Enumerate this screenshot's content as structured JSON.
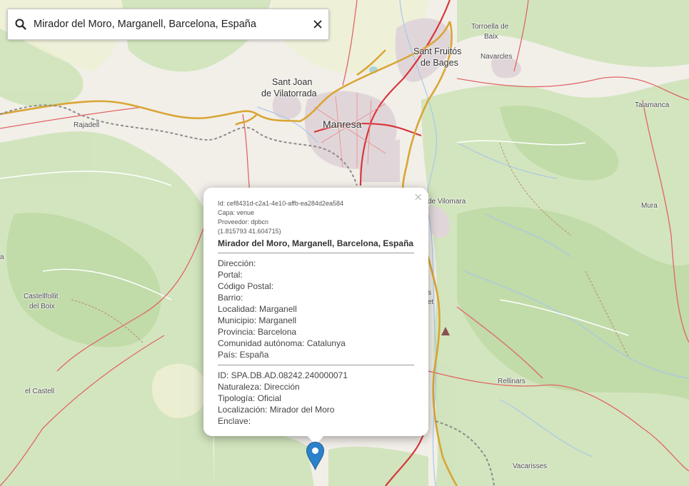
{
  "search": {
    "value": "Mirador del Moro, Marganell, Barcelona, España",
    "placeholder": ""
  },
  "map": {
    "places": {
      "manresa": "Manresa",
      "sant_joan_1": "Sant Joan",
      "sant_joan_2": "de Vilatorrada",
      "sant_fruitos_1": "Sant Fruitós",
      "sant_fruitos_2": "de Bages",
      "torroella_1": "Torroella de",
      "torroella_2": "Baix",
      "navarcles": "Navarcles",
      "talamanca": "Talamanca",
      "rajadell": "Rajadell",
      "vilomara": "de Vilomara",
      "mura": "Mura",
      "castellfollit_1": "Castellfollit",
      "castellfollit_2": "del Boix",
      "el_castell": "el Castell",
      "rellinars": "Rellinars",
      "vacarisses": "Vacarisses",
      "a_edge": "a",
      "s_edge": "s",
      "et_edge": "et"
    }
  },
  "popup": {
    "close_label": "×",
    "meta": {
      "id": "Id: cef8431d-c2a1-4e10-affb-ea284d2ea584",
      "capa": "Capa: venue",
      "proveedor": "Proveedor: dpbcn",
      "coords": "(1.815793 41.604715)"
    },
    "title": "Mirador del Moro, Marganell, Barcelona, España",
    "address": {
      "direccion": "Dirección:",
      "portal": "Portal:",
      "codigo_postal": "Código Postal:",
      "barrio": "Barrio:",
      "localidad": "Localidad: Marganell",
      "municipio": "Municipio: Marganell",
      "provincia": "Provincia: Barcelona",
      "comunidad": "Comunidad autónoma: Catalunya",
      "pais": "País: España"
    },
    "details": {
      "id": "ID: SPA.DB.AD.08242.240000071",
      "naturaleza": "Naturaleza: Dirección",
      "tipologia": "Tipología: Oficial",
      "localizacion": "Localización: Mirador del Moro",
      "enclave": "Enclave:"
    }
  },
  "marker": {
    "color": "#2b82cb",
    "icon": "map-pin-icon"
  }
}
